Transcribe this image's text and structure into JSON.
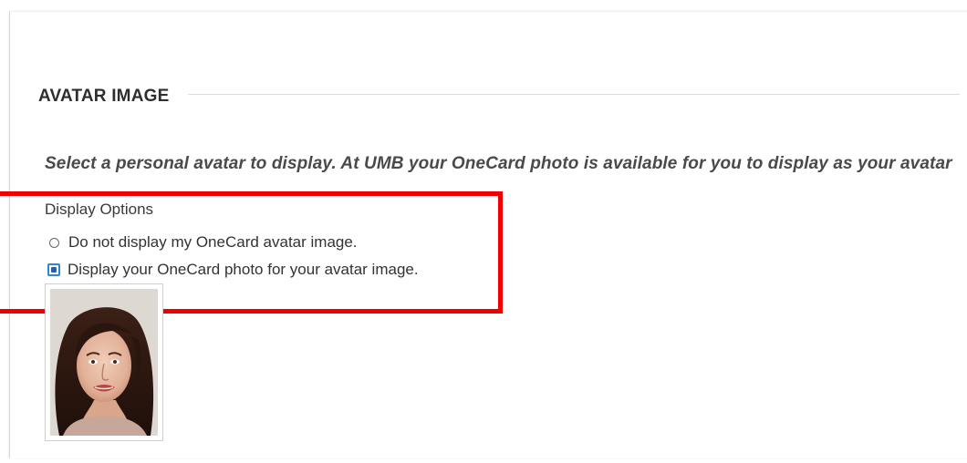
{
  "section": {
    "title": "AVATAR IMAGE"
  },
  "instructions": "Select a personal avatar to display. At UMB your OneCard photo is available for you to display as your avatar",
  "display_options": {
    "label": "Display Options",
    "options": [
      {
        "label": "Do not display my OneCard avatar image.",
        "selected": false
      },
      {
        "label": "Display your OneCard photo for your avatar image.",
        "selected": true
      }
    ]
  },
  "colors": {
    "highlight": "#f00000",
    "radio_selected": "#2f86d8"
  }
}
